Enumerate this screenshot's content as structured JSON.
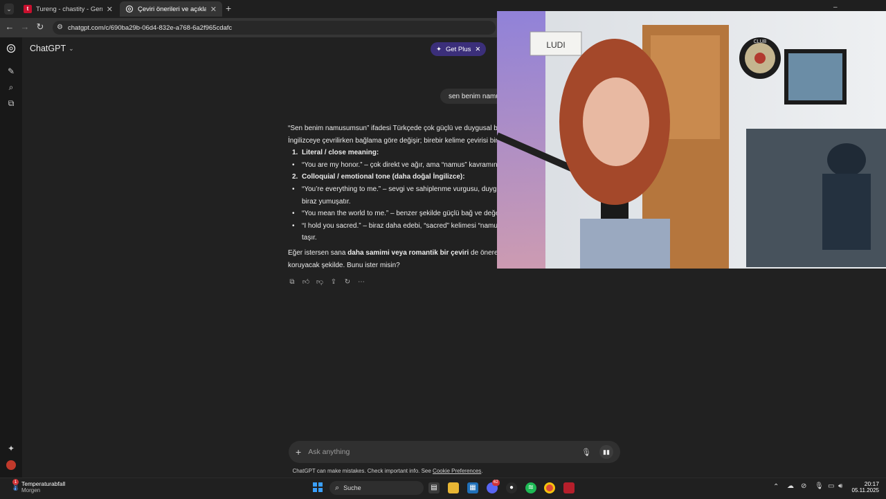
{
  "browser": {
    "tabs": [
      {
        "label": "Tureng - chastity - German Eng",
        "active": false,
        "favicon_color": "#c8102e"
      },
      {
        "label": "Çeviri önerileri ve açıklama",
        "active": true,
        "favicon_color": "#cfcfcf"
      }
    ],
    "new_tab": "+",
    "url": "chatgpt.com/c/690ba29b-06d4-832e-a768-6a2f965cdafc",
    "window_controls": [
      "–",
      "▢",
      "✕"
    ]
  },
  "app": {
    "model_label": "ChatGPT",
    "get_plus_label": "Get Plus",
    "user_message": "sen benim namusumsun",
    "answer": {
      "intro": [
        "“Sen benim namusumsun” ifadesi Türkçede çok güçlü ve duygusal bi",
        "İngilizceye çevrilirken bağlama göre değişir; birebir kelime çevirisi bir"
      ],
      "h1": "Literal / close meaning:",
      "h1_bullet_quote": "“You are my honor.”",
      "h1_bullet_rest": " – çok direkt ve ağır, ama “namus” kavramını",
      "h2": "Colloquial / emotional tone (daha doğal İngilizce):",
      "b2a_quote": "“You’re everything to me.”",
      "b2a_rest": " – sevgi ve sahiplenme vurgusu, duygu",
      "b2a_cont": "biraz yumuşatır.",
      "b2b_quote": "“You mean the world to me.”",
      "b2b_rest": " – benzer şekilde güçlü bağ ve değe",
      "b2c_quote": "“I hold you sacred.”",
      "b2c_rest": " – biraz daha edebi, “sacred” kelimesi “namus",
      "b2c_cont": "taşır.",
      "outro_pre": "Eğer istersen sana ",
      "outro_bold": "daha samimi veya romantik bir çeviri",
      "outro_post": " de önerebil",
      "outro_line2": "koruyacak şekilde. Bunu ister misin?"
    },
    "composer_placeholder": "Ask anything",
    "disclaimer_text": "ChatGPT can make mistakes. Check important info. See ",
    "disclaimer_link": "Cookie Preferences",
    "disclaimer_end": "."
  },
  "webcam": {
    "letterboard_text": "LUDI",
    "dartboard_text": "CLUB"
  },
  "taskbar": {
    "weather_title": "Temperaturabfall",
    "weather_subtitle": "Morgen",
    "weather_badge": "1",
    "search_label": "Suche",
    "discord_badge": "62",
    "time": "20:17",
    "date": "05.11.2025"
  }
}
